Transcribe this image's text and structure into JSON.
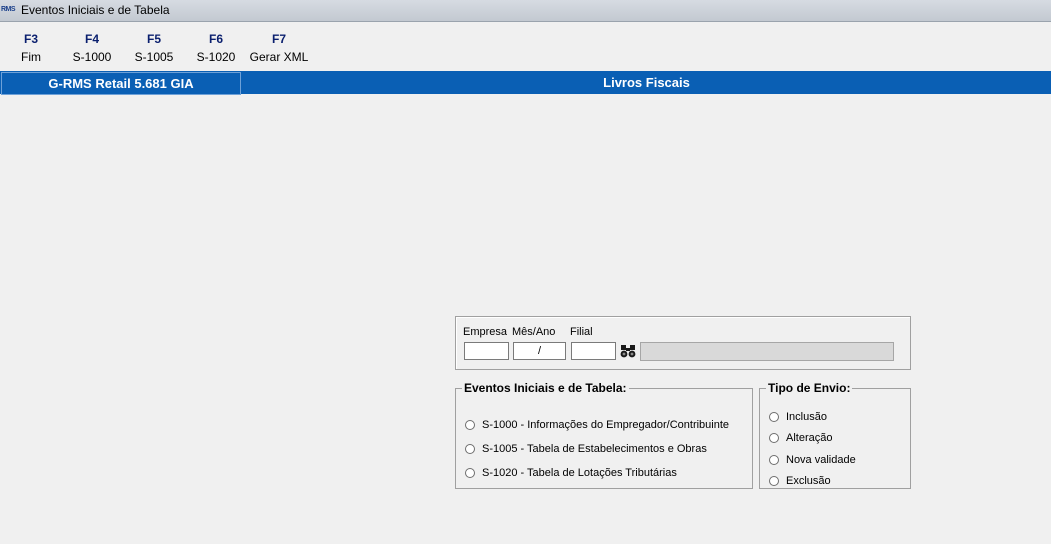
{
  "window": {
    "title": "Eventos Iniciais e de Tabela",
    "icon_text": "RMS"
  },
  "toolbar": [
    {
      "key": "F3",
      "label": "Fim"
    },
    {
      "key": "F4",
      "label": "S-1000"
    },
    {
      "key": "F5",
      "label": "S-1005"
    },
    {
      "key": "F6",
      "label": "S-1020"
    },
    {
      "key": "F7",
      "label": "Gerar XML"
    }
  ],
  "header": {
    "left": "G-RMS Retail 5.681 GIA",
    "right": "Livros Fiscais"
  },
  "filter": {
    "empresa_label": "Empresa",
    "mesano_label": "Mês/Ano",
    "filial_label": "Filial",
    "empresa_value": "",
    "mesano_value": "/",
    "filial_value": ""
  },
  "eventos": {
    "title": "Eventos Iniciais e de Tabela:",
    "options": [
      "S-1000 - Informações do Empregador/Contribuinte",
      "S-1005 - Tabela de Estabelecimentos e Obras",
      "S-1020 - Tabela de Lotações Tributárias"
    ]
  },
  "envio": {
    "title": "Tipo de Envio:",
    "options": [
      "Inclusão",
      "Alteração",
      "Nova validade",
      "Exclusão"
    ]
  },
  "colors": {
    "header_bg": "#0a5fb4",
    "key_color": "#0a1f6e"
  }
}
